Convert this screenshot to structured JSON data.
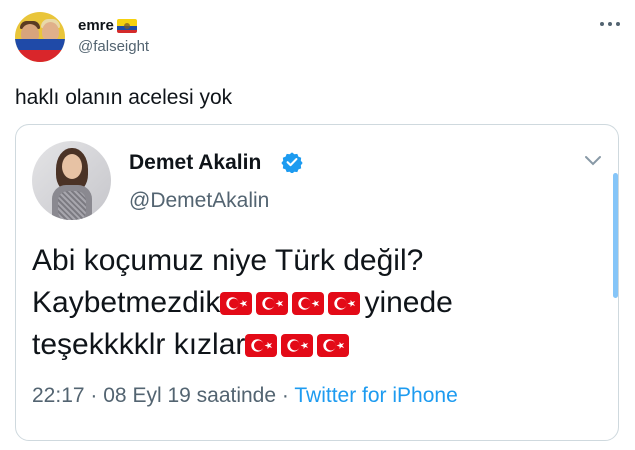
{
  "tweet": {
    "display_name": "emre",
    "name_flag_icon": "ecuador-flag-icon",
    "handle": "@falseight",
    "text": "haklı olanın acelesi yok",
    "more_icon": "more-options-icon"
  },
  "quoted": {
    "name": "Demet Akalin",
    "verified_icon": "verified-badge-icon",
    "handle": "@DemetAkalin",
    "lines": [
      {
        "text": "Abi koçumuz niye Türk değil?",
        "flags": 0,
        "after": ""
      },
      {
        "text": "Kaybetmezdik",
        "flags": 4,
        "after": "yinede"
      },
      {
        "text": "teşekkkklr kızlar",
        "flags": 3,
        "after": ""
      }
    ],
    "flag_icon": "turkey-flag-icon",
    "time": "22:17",
    "sep1": "·",
    "date": "08 Eyl 19 saatinde",
    "sep2": "·",
    "source": "Twitter for iPhone",
    "chevron_icon": "chevron-down-icon"
  },
  "colors": {
    "link": "#1d9bf0",
    "muted": "#536471",
    "turkish_red": "#e30a17",
    "card_border": "#cfd9de"
  }
}
